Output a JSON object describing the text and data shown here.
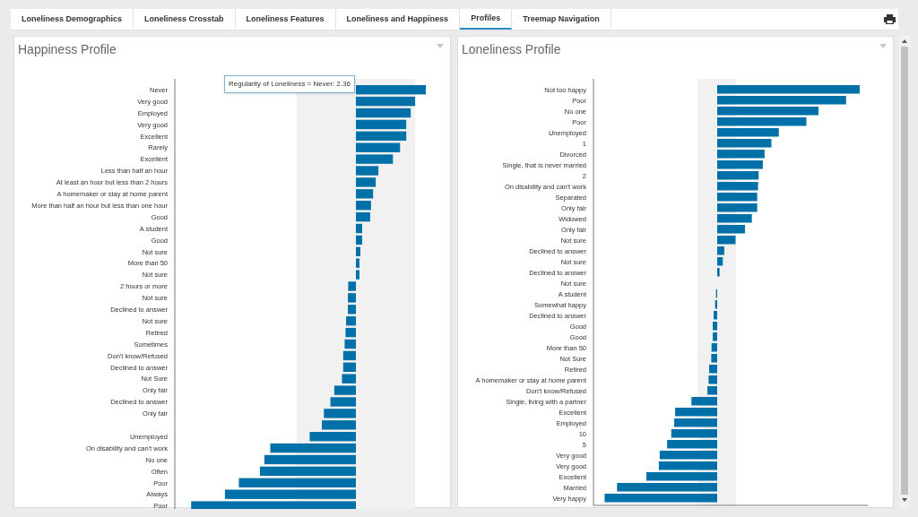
{
  "tabs": [
    {
      "label": "Loneliness Demographics",
      "selected": false
    },
    {
      "label": "Loneliness Crosstab",
      "selected": false
    },
    {
      "label": "Loneliness Features",
      "selected": false
    },
    {
      "label": "Loneliness and Happiness",
      "selected": false
    },
    {
      "label": "Profiles",
      "selected": true
    },
    {
      "label": "Treemap Navigation",
      "selected": false
    }
  ],
  "panels": [
    {
      "title": "Happiness Profile",
      "tooltip": "Regularity of Loneliness = Never: 2.36",
      "bar_labels": [
        "Never",
        "Very good",
        "Employed",
        "Very good",
        "Excellent",
        "Rarely",
        "Excellent",
        "Less than half an hour",
        "At least an hour but less than 2 hours",
        "A homemaker or stay at home parent",
        "More than half an hour but less than one hour",
        "Good",
        "A student",
        "Good",
        "Not sure",
        "More than 50",
        "Not sure",
        "2 hours or more",
        "Not sure",
        "Declined to answer",
        "Not sure",
        "Retired",
        "Sometimes",
        "Don't know/Refused",
        "Declined to answer",
        "Not Sure",
        "Only fair",
        "Declined to answer",
        "Only fair",
        {
          "unlabeled": true
        },
        "Unemployed",
        "On disability and can't work",
        "No one",
        "Often",
        "Poor",
        "Always",
        "Poor"
      ]
    },
    {
      "title": "Loneliness Profile",
      "bar_labels": [
        "Not too happy",
        "Poor",
        "No one",
        "Poor",
        "Unemployed",
        "1",
        "Divorced",
        "Single, that is never married",
        "2",
        "On disability and can't work",
        "Separated",
        "Only fair",
        "Widowed",
        "Only fair",
        "Not sure",
        "Declined to answer",
        "Not sure",
        "Declined to answer",
        "Not sure",
        "A student",
        "Somewhat happy",
        "Declined to answer",
        "Good",
        "Good",
        "More than 50",
        "Not Sure",
        "Retired",
        "A homemaker or stay at home parent",
        "Don't know/Refused",
        "Single, living with a partner",
        "Excellent",
        "Employed",
        "10",
        "5",
        "Very good",
        "Very good",
        "Excellent",
        "Married",
        "Very happy"
      ]
    }
  ]
}
